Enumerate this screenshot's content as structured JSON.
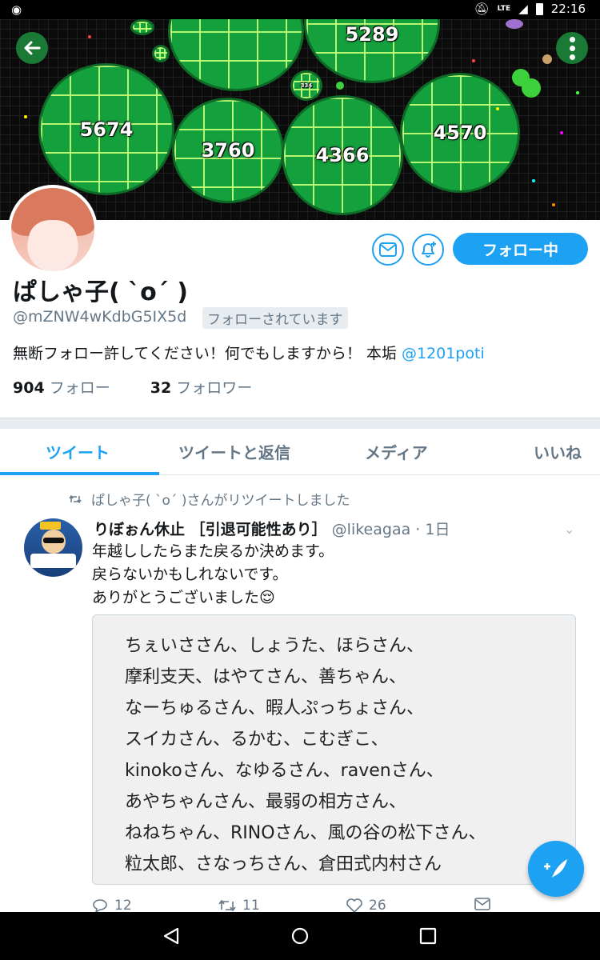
{
  "status_bar": {
    "time": "22:16",
    "network": "LTE"
  },
  "banner": {
    "cells": [
      {
        "value": "5674"
      },
      {
        "value": "3760"
      },
      {
        "value": "4366"
      },
      {
        "value": "4570"
      },
      {
        "value": "5289"
      },
      {
        "value": "334"
      }
    ]
  },
  "profile": {
    "name": "ぱしゃ子( `o´ )",
    "handle": "@mZNW4wKdbG5IX5d",
    "follows_you": "フォローされています",
    "bio": "無断フォロー許してください！何でもしますから！ 本垢",
    "bio_link": "@1201poti",
    "following_count": "904",
    "following_label": "フォロー",
    "followers_count": "32",
    "followers_label": "フォロワー",
    "follow_button": "フォロー中"
  },
  "tabs": [
    {
      "label": "ツイート"
    },
    {
      "label": "ツイートと返信"
    },
    {
      "label": "メディア"
    },
    {
      "label": "いいね"
    }
  ],
  "tweet": {
    "retweet_note": "ぱしゃ子( `o´ )さんがリツイートしました",
    "author_name": "りぼぉん休止 ［引退可能性あり］",
    "author_handle": "@likeagaa",
    "time": "1日",
    "text_lines": [
      "年越ししたらまた戻るか決めます。",
      "戻らないかもしれないです。",
      "ありがとうございました😌"
    ],
    "image_lines": [
      "ちぇいささん、しょうた、ほらさん、",
      "摩利支天、はやてさん、善ちゃん、",
      "なーちゅるさん、暇人ぷっちょさん、",
      "スイカさん、るかむ、こむぎこ、",
      "kinokoさん、なゆるさん、ravenさん、",
      "あやちゃんさん、最弱の相方さん、",
      "ねねちゃん、RINOさん、風の谷の松下さん、",
      "粒太郎、さなっちさん、倉田式内村さん"
    ],
    "reply_count": "12",
    "retweet_count": "11",
    "like_count": "26"
  },
  "colors": {
    "accent": "#1da1f2",
    "muted": "#657786",
    "divider": "#e6ecf0"
  }
}
